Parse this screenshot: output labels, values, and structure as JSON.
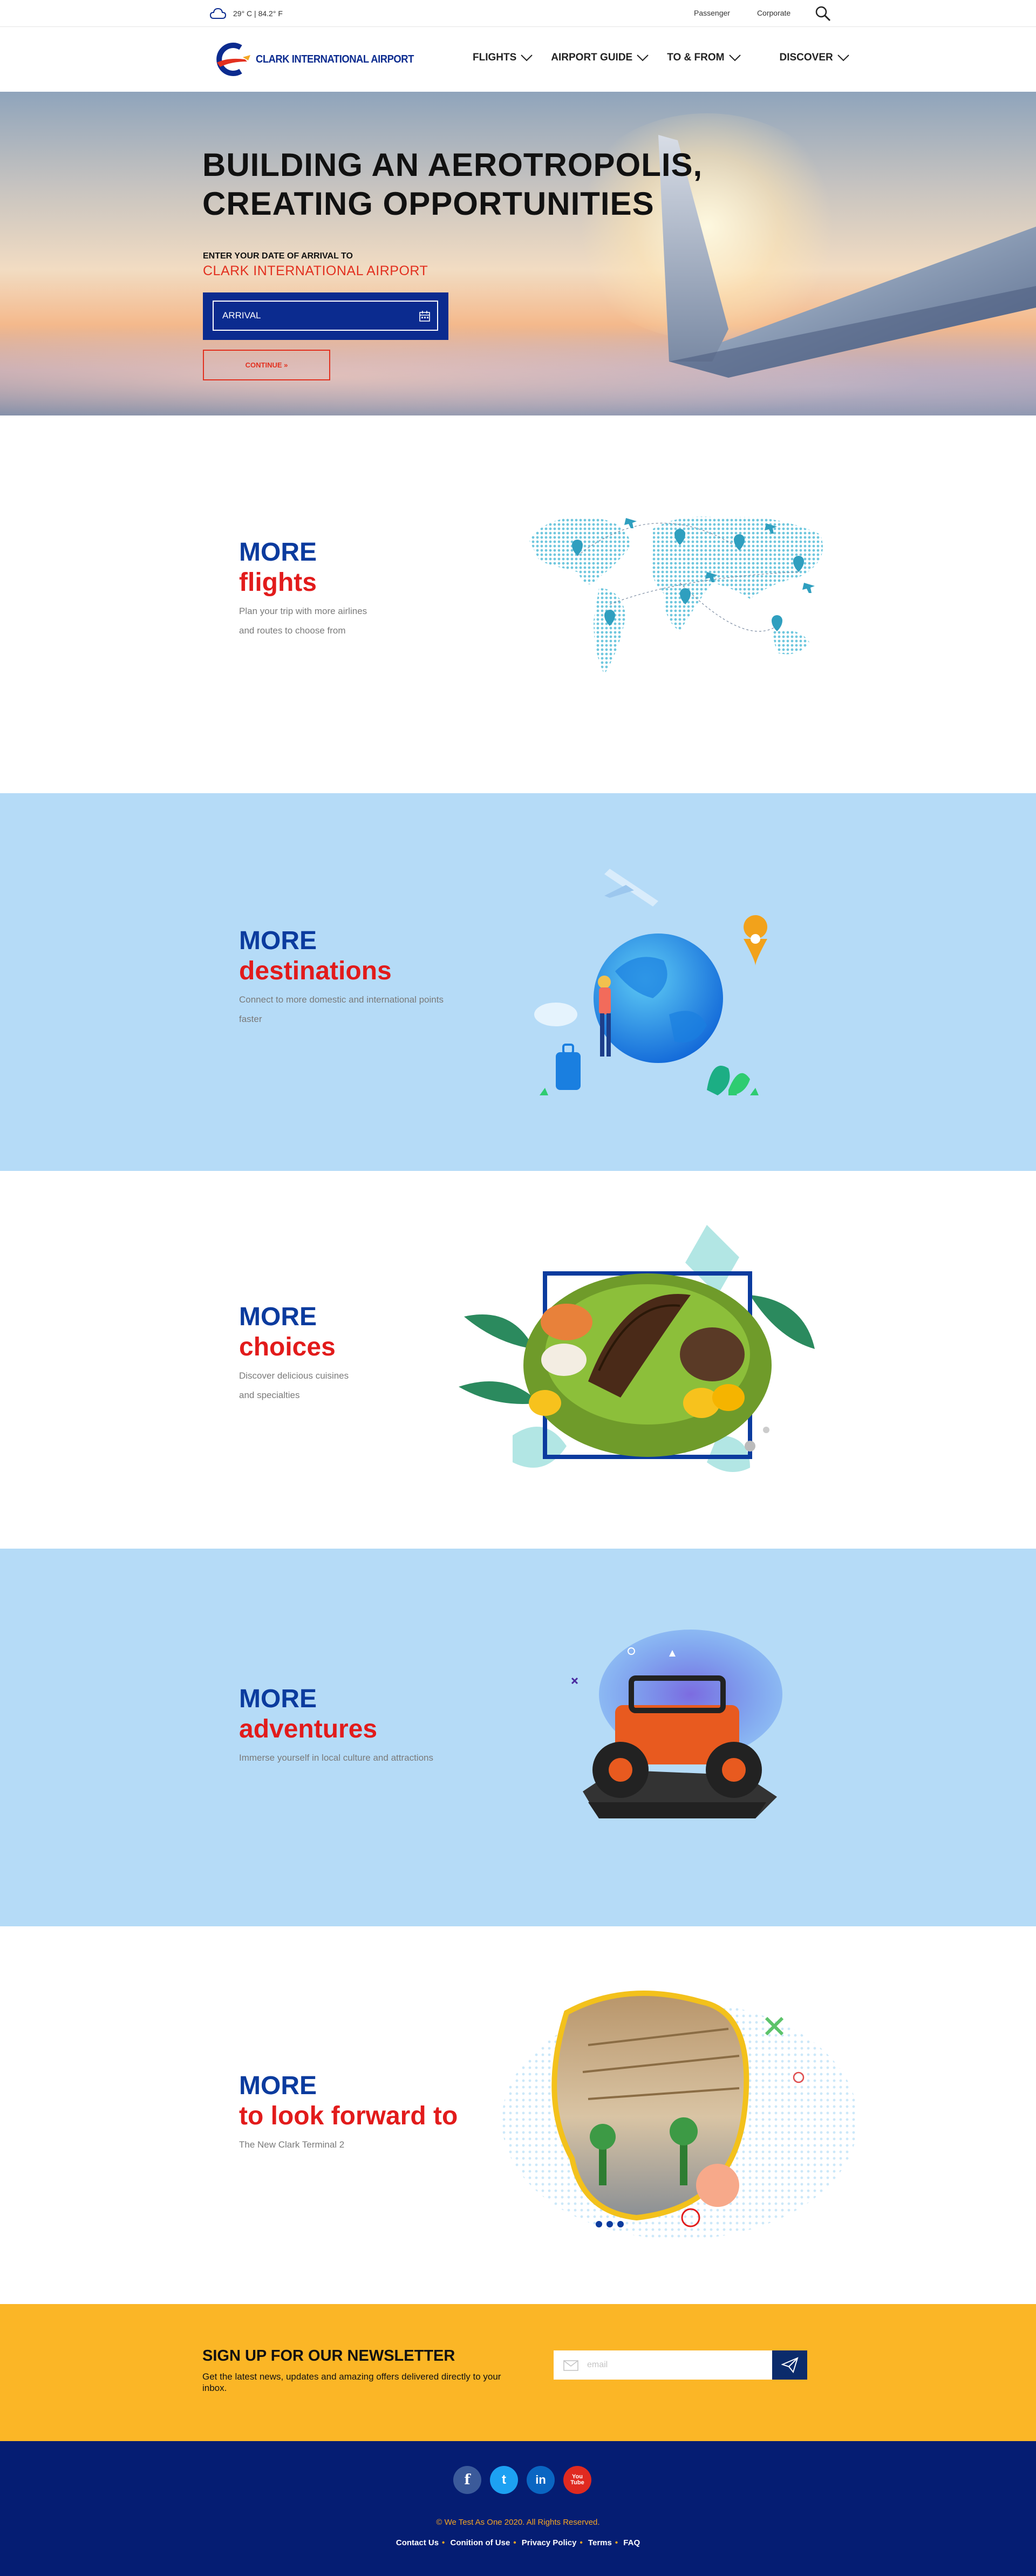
{
  "weather": {
    "text": "29° C | 84.2° F"
  },
  "topbar": {
    "links": [
      "Passenger",
      "Corporate"
    ]
  },
  "logo": {
    "text": "CLARK INTERNATIONAL AIRPORT"
  },
  "nav": {
    "items": [
      "FLIGHTS",
      "AIRPORT GUIDE",
      "TO & FROM",
      "DISCOVER"
    ]
  },
  "hero": {
    "title_line1": "BUILDING AN AEROTROPOLIS,",
    "title_line2": "CREATING OPPORTUNITIES",
    "sub1": "ENTER YOUR DATE OF ARRIVAL TO",
    "sub2": "CLARK INTERNATIONAL AIRPORT",
    "arrival_placeholder": "ARRIVAL",
    "continue_label": "CONTINUE »"
  },
  "features": [
    {
      "more": "MORE",
      "word": "flights",
      "desc_line1": "Plan your trip with more airlines",
      "desc_line2": "and routes to choose from"
    },
    {
      "more": "MORE",
      "word": "destinations",
      "desc_line1": "Connect to more domestic and international points",
      "desc_line2": "faster"
    },
    {
      "more": "MORE",
      "word": "choices",
      "desc_line1": "Discover delicious cuisines",
      "desc_line2": "and specialties"
    },
    {
      "more": "MORE",
      "word": "adventures",
      "desc_line1": "Immerse yourself in local culture and attractions",
      "desc_line2": ""
    },
    {
      "more": "MORE",
      "word": "to look forward to",
      "desc_line1": "The New Clark Terminal 2",
      "desc_line2": ""
    }
  ],
  "newsletter": {
    "title": "SIGN UP FOR OUR NEWSLETTER",
    "desc": "Get the latest news, updates and amazing offers delivered directly to your inbox.",
    "placeholder": "email"
  },
  "footer": {
    "socials": [
      "f",
      "t",
      "in",
      "You Tube"
    ],
    "copyright": "© We Test As One 2020. All Rights Reserved.",
    "links": [
      "Contact Us",
      "Conition of Use",
      "Privacy Policy",
      "Terms",
      "FAQ"
    ]
  },
  "colors": {
    "brand_blue": "#0b2b8f",
    "brand_red": "#e21b1b",
    "section_blue": "#b5dbf7",
    "newsletter_yellow": "#fbb626",
    "footer_navy": "#051d73"
  }
}
